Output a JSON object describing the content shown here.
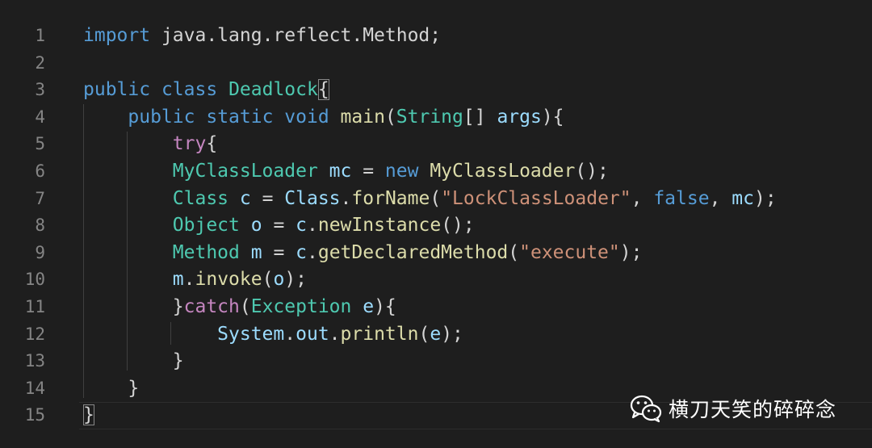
{
  "editor": {
    "line_numbers": [
      "1",
      "2",
      "3",
      "4",
      "5",
      "6",
      "7",
      "8",
      "9",
      "10",
      "11",
      "12",
      "13",
      "14",
      "15"
    ],
    "lines": [
      [
        {
          "c": "kw",
          "t": "import"
        },
        {
          "c": "plain",
          "t": " java.lang.reflect.Method;"
        }
      ],
      [],
      [
        {
          "c": "kw",
          "t": "public"
        },
        {
          "c": "plain",
          "t": " "
        },
        {
          "c": "kw",
          "t": "class"
        },
        {
          "c": "plain",
          "t": " "
        },
        {
          "c": "type",
          "t": "Deadlock"
        },
        {
          "c": "plain bracket-match",
          "t": "{"
        }
      ],
      [
        {
          "c": "plain",
          "t": "    "
        },
        {
          "c": "kw",
          "t": "public"
        },
        {
          "c": "plain",
          "t": " "
        },
        {
          "c": "kw",
          "t": "static"
        },
        {
          "c": "plain",
          "t": " "
        },
        {
          "c": "kw",
          "t": "void"
        },
        {
          "c": "plain",
          "t": " "
        },
        {
          "c": "fn",
          "t": "main"
        },
        {
          "c": "plain",
          "t": "("
        },
        {
          "c": "type",
          "t": "String"
        },
        {
          "c": "plain",
          "t": "[] "
        },
        {
          "c": "var",
          "t": "args"
        },
        {
          "c": "plain",
          "t": "){"
        }
      ],
      [
        {
          "c": "plain",
          "t": "        "
        },
        {
          "c": "kw2",
          "t": "try"
        },
        {
          "c": "plain",
          "t": "{"
        }
      ],
      [
        {
          "c": "plain",
          "t": "        "
        },
        {
          "c": "type",
          "t": "MyClassLoader"
        },
        {
          "c": "plain",
          "t": " "
        },
        {
          "c": "var",
          "t": "mc"
        },
        {
          "c": "plain",
          "t": " = "
        },
        {
          "c": "kw",
          "t": "new"
        },
        {
          "c": "plain",
          "t": " "
        },
        {
          "c": "fn",
          "t": "MyClassLoader"
        },
        {
          "c": "plain",
          "t": "();"
        }
      ],
      [
        {
          "c": "plain",
          "t": "        "
        },
        {
          "c": "type",
          "t": "Class"
        },
        {
          "c": "plain",
          "t": " "
        },
        {
          "c": "var",
          "t": "c"
        },
        {
          "c": "plain",
          "t": " = "
        },
        {
          "c": "var",
          "t": "Class"
        },
        {
          "c": "plain",
          "t": "."
        },
        {
          "c": "fn",
          "t": "forName"
        },
        {
          "c": "plain",
          "t": "("
        },
        {
          "c": "str",
          "t": "\"LockClassLoader\""
        },
        {
          "c": "plain",
          "t": ", "
        },
        {
          "c": "kw",
          "t": "false"
        },
        {
          "c": "plain",
          "t": ", "
        },
        {
          "c": "var",
          "t": "mc"
        },
        {
          "c": "plain",
          "t": ");"
        }
      ],
      [
        {
          "c": "plain",
          "t": "        "
        },
        {
          "c": "type",
          "t": "Object"
        },
        {
          "c": "plain",
          "t": " "
        },
        {
          "c": "var",
          "t": "o"
        },
        {
          "c": "plain",
          "t": " = "
        },
        {
          "c": "var",
          "t": "c"
        },
        {
          "c": "plain",
          "t": "."
        },
        {
          "c": "fn",
          "t": "newInstance"
        },
        {
          "c": "plain",
          "t": "();"
        }
      ],
      [
        {
          "c": "plain",
          "t": "        "
        },
        {
          "c": "type",
          "t": "Method"
        },
        {
          "c": "plain",
          "t": " "
        },
        {
          "c": "var",
          "t": "m"
        },
        {
          "c": "plain",
          "t": " = "
        },
        {
          "c": "var",
          "t": "c"
        },
        {
          "c": "plain",
          "t": "."
        },
        {
          "c": "fn",
          "t": "getDeclaredMethod"
        },
        {
          "c": "plain",
          "t": "("
        },
        {
          "c": "str",
          "t": "\"execute\""
        },
        {
          "c": "plain",
          "t": ");"
        }
      ],
      [
        {
          "c": "plain",
          "t": "        "
        },
        {
          "c": "var",
          "t": "m"
        },
        {
          "c": "plain",
          "t": "."
        },
        {
          "c": "fn",
          "t": "invoke"
        },
        {
          "c": "plain",
          "t": "("
        },
        {
          "c": "var",
          "t": "o"
        },
        {
          "c": "plain",
          "t": ");"
        }
      ],
      [
        {
          "c": "plain",
          "t": "        }"
        },
        {
          "c": "kw2",
          "t": "catch"
        },
        {
          "c": "plain",
          "t": "("
        },
        {
          "c": "type",
          "t": "Exception"
        },
        {
          "c": "plain",
          "t": " "
        },
        {
          "c": "var",
          "t": "e"
        },
        {
          "c": "plain",
          "t": "){"
        }
      ],
      [
        {
          "c": "plain",
          "t": "            "
        },
        {
          "c": "var",
          "t": "System"
        },
        {
          "c": "plain",
          "t": "."
        },
        {
          "c": "var",
          "t": "out"
        },
        {
          "c": "plain",
          "t": "."
        },
        {
          "c": "fn",
          "t": "println"
        },
        {
          "c": "plain",
          "t": "("
        },
        {
          "c": "var",
          "t": "e"
        },
        {
          "c": "plain",
          "t": ");"
        }
      ],
      [
        {
          "c": "plain",
          "t": "        }"
        }
      ],
      [
        {
          "c": "plain",
          "t": "    }"
        }
      ],
      [
        {
          "c": "plain bracket-match",
          "t": "}"
        }
      ]
    ]
  },
  "watermark": {
    "text": "横刀天笑的碎碎念",
    "icon": "wechat-icon"
  },
  "colors": {
    "background": "#1e1e1e",
    "keyword": "#569cd6",
    "control_keyword": "#c586c0",
    "type": "#4ec9b0",
    "function": "#dcdcaa",
    "string": "#ce9178",
    "variable": "#9cdcfe",
    "line_number": "#858585"
  }
}
